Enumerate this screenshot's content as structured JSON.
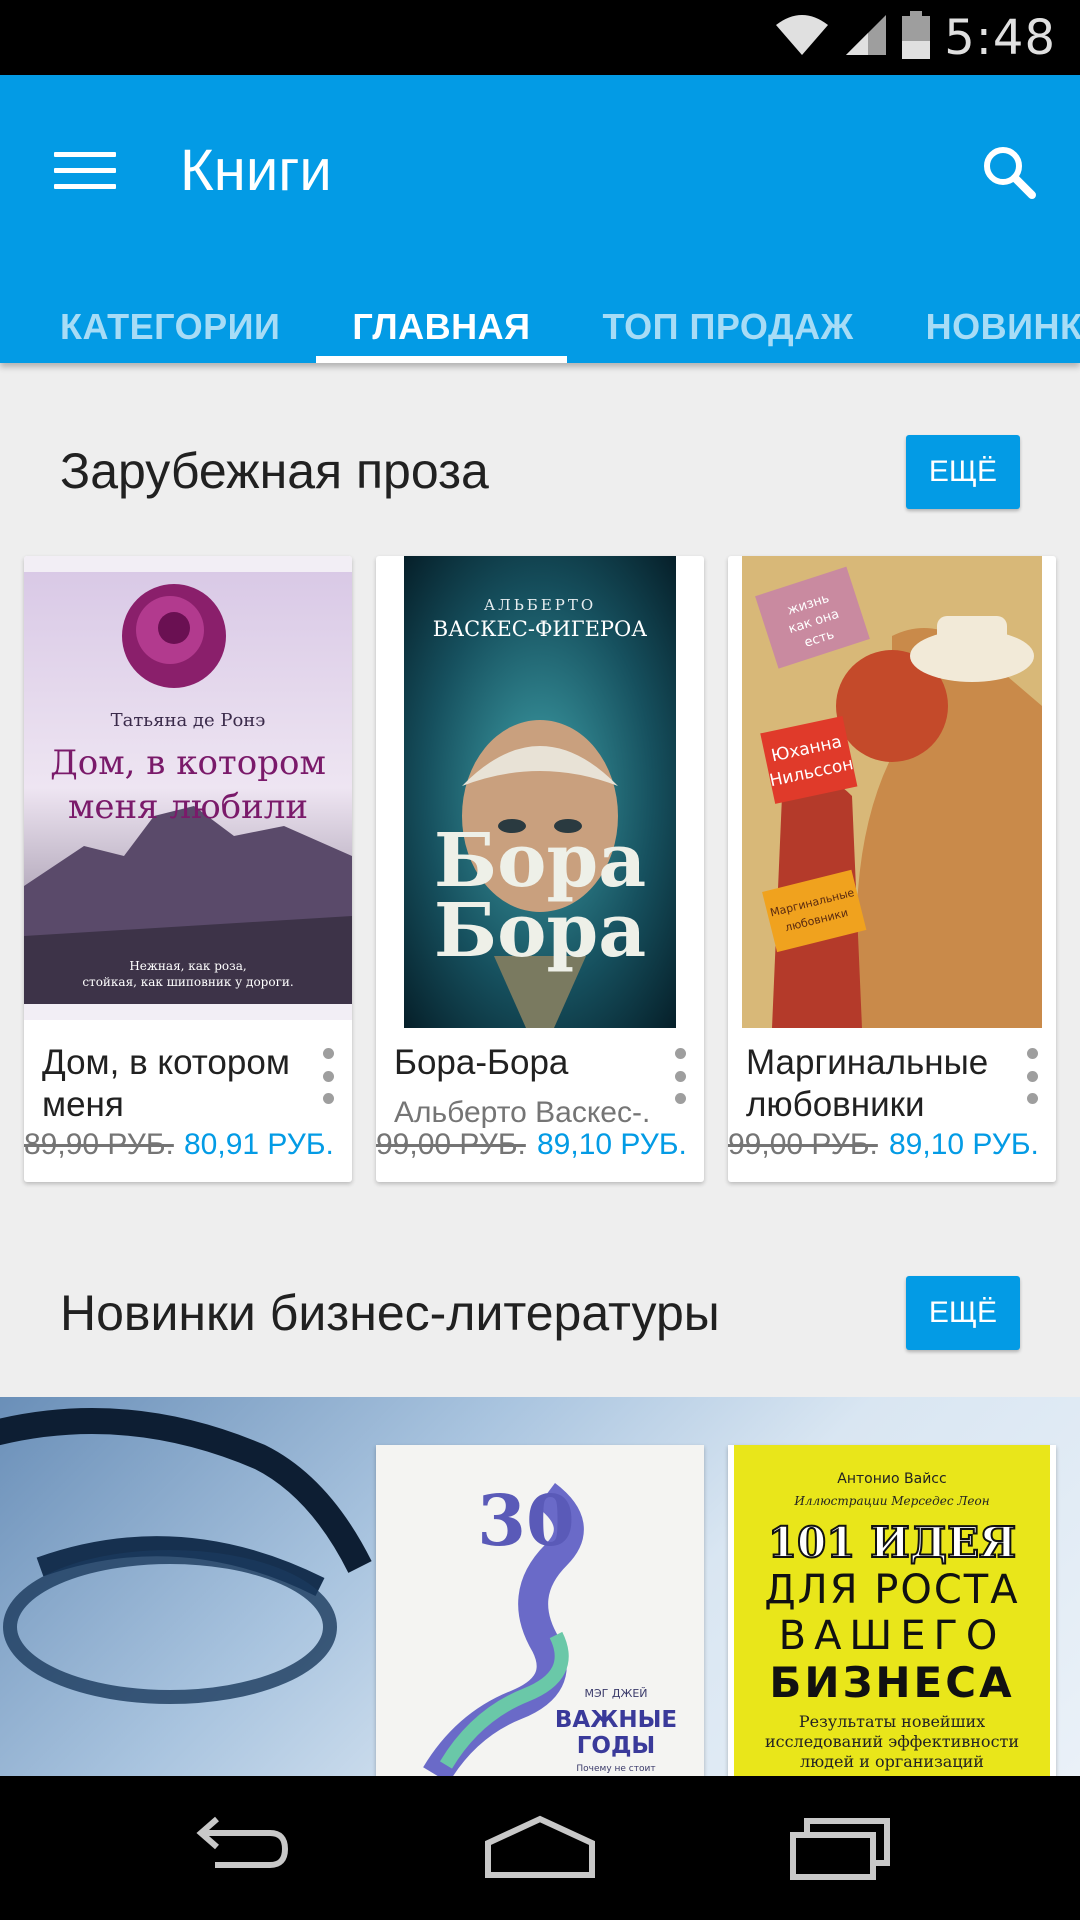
{
  "status_bar": {
    "time": "5:48"
  },
  "app_bar": {
    "title": "Книги"
  },
  "tabs": [
    "КАТЕГОРИИ",
    "ГЛАВНАЯ",
    "ТОП ПРОДАЖ",
    "НОВИНКИ Х"
  ],
  "active_tab": "ГЛАВНАЯ",
  "sections": [
    {
      "title": "Зарубежная проза",
      "more_label": "ЕЩЁ",
      "books": [
        {
          "title": "Дом, в котором меня",
          "author": "",
          "old_price": "89,90 РУБ.",
          "new_price": "80,91 РУБ.",
          "cover": {
            "author": "Татьяна де Ронэ",
            "title_line1": "Дом, в котором",
            "title_line2": "меня любили",
            "tagline1": "Нежная, как роза,",
            "tagline2": "стойкая, как шиповник у дороги."
          }
        },
        {
          "title": "Бора-Бора",
          "author": "Альберто Васкес-.",
          "old_price": "99,00 РУБ.",
          "new_price": "89,10 РУБ.",
          "cover": {
            "author_line1": "АЛЬБЕРТО",
            "author_line2": "ВАСКЕС-ФИГЕРОА",
            "title_line1": "Бора",
            "title_line2": "Бора"
          }
        },
        {
          "title": "Маргинальные любовники",
          "author": "",
          "old_price": "99,00 РУБ.",
          "new_price": "89,10 РУБ.",
          "cover": {
            "sticker1_line1": "жизнь",
            "sticker1_line2": "как она",
            "sticker1_line3": "есть",
            "author_line1": "Юханна",
            "author_line2": "Нильссон",
            "title_line1": "Маргинальные",
            "title_line2": "любовники"
          }
        }
      ]
    },
    {
      "title": "Новинки бизнес-литературы",
      "more_label": "ЕЩЁ",
      "books": [
        {
          "cover": {
            "number": "30",
            "author": "МЭГ ДЖЕЙ",
            "title_line1": "ВАЖНЫЕ",
            "title_line2": "ГОДЫ",
            "subtitle": "Почему не стоит"
          }
        },
        {
          "cover": {
            "author": "Антонио Вайсс",
            "illustrator": "Иллюстрации Мерседес Леон",
            "title_line1": "101 ИДЕЯ",
            "title_line2": "ДЛЯ РОСТА",
            "title_line3": "ВАШЕГО",
            "title_line4": "БИЗНЕСА",
            "subtitle_line1": "Результаты новейших",
            "subtitle_line2": "исследований эффективности",
            "subtitle_line3": "людей и организаций"
          }
        }
      ]
    }
  ],
  "colors": {
    "accent": "#039be5",
    "background": "#eeeeee"
  },
  "icons": [
    "wifi-icon",
    "signal-icon",
    "battery-icon",
    "menu-icon",
    "search-icon",
    "overflow-icon",
    "back-icon",
    "home-icon",
    "recents-icon"
  ]
}
